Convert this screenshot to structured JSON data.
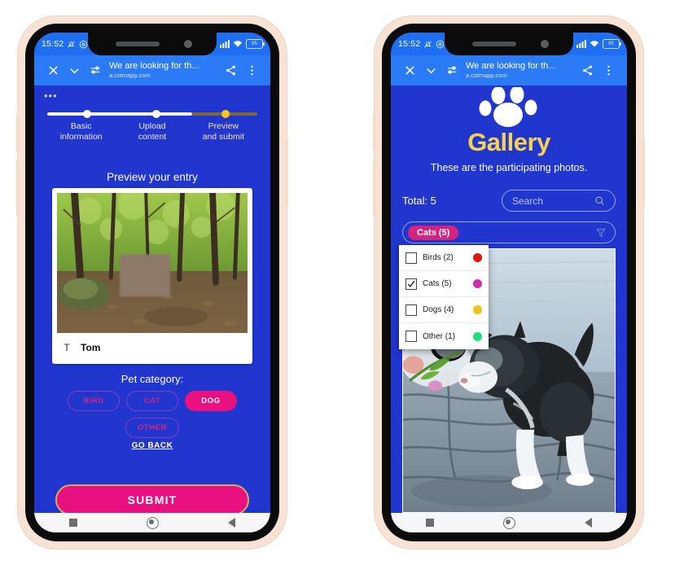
{
  "status_bar": {
    "time": "15:52",
    "mute_icon": "bell-muted-icon",
    "signal_icon": "cellular-signal-icon",
    "wifi_icon": "wifi-icon",
    "battery_level": "95"
  },
  "browser_bar": {
    "close_icon": "close-icon",
    "chevron_icon": "chevron-down-icon",
    "settings_icon": "page-settings-icon",
    "title": "We are looking for th...",
    "url": "a.cstmapp.com",
    "share_icon": "share-icon",
    "menu_icon": "more-vertical-icon"
  },
  "nav_bar": {
    "recents_icon": "square-recents-icon",
    "home_icon": "circle-home-icon",
    "back_icon": "triangle-back-icon"
  },
  "left_phone": {
    "overflow_dots": "•••",
    "stepper": {
      "steps": [
        {
          "label": "Basic\ninformation",
          "state": "done"
        },
        {
          "label": "Upload\ncontent",
          "state": "done"
        },
        {
          "label": "Preview\nand submit",
          "state": "active"
        }
      ],
      "step_1_line1": "Basic",
      "step_1_line2": "information",
      "step_2_line1": "Upload",
      "step_2_line2": "content",
      "step_3_line1": "Preview",
      "step_3_line2": "and submit"
    },
    "preview_heading": "Preview your entry",
    "entry": {
      "avatar_letter": "T",
      "name": "Tom",
      "photo_alt": "forest-photo"
    },
    "category_label": "Pet category:",
    "chips": [
      {
        "label": "BIRD",
        "selected": false
      },
      {
        "label": "CAT",
        "selected": false
      },
      {
        "label": "DOG",
        "selected": true
      },
      {
        "label": "OTHER",
        "selected": false
      }
    ],
    "chip_bird": "BIRD",
    "chip_cat": "CAT",
    "chip_dog": "DOG",
    "chip_other": "OTHER",
    "go_back": "GO BACK",
    "submit": "SUBMIT"
  },
  "right_phone": {
    "paw_icon": "paw-print-icon",
    "title": "Gallery",
    "subtitle": "These are the participating photos.",
    "total": "Total: 5",
    "search_placeholder": "Search",
    "search_icon": "search-icon",
    "filter_icon": "filter-funnel-icon",
    "selected_tag": "Cats (5)",
    "dropdown": {
      "items": [
        {
          "label": "Birds (2)",
          "checked": false,
          "color": "#e8120d"
        },
        {
          "label": "Cats (5)",
          "checked": true,
          "color": "#d42ba8"
        },
        {
          "label": "Dogs (4)",
          "checked": false,
          "color": "#eec21c"
        },
        {
          "label": "Other (1)",
          "checked": false,
          "color": "#1fe07a"
        }
      ],
      "item_0_label": "Birds (2)",
      "item_1_label": "Cats (5)",
      "item_2_label": "Dogs (4)",
      "item_3_label": "Other (1)"
    },
    "photo_alt": "kitten-photo"
  },
  "colors": {
    "page_blue": "#2135cf",
    "browser_blue": "#2b7bf7",
    "status_blue": "#1f6ff5",
    "accent_pink": "#e8117f",
    "accent_yellow": "#f5d250",
    "gold_border": "#d8ab5c",
    "phone_frame": "#f7e2d4"
  }
}
